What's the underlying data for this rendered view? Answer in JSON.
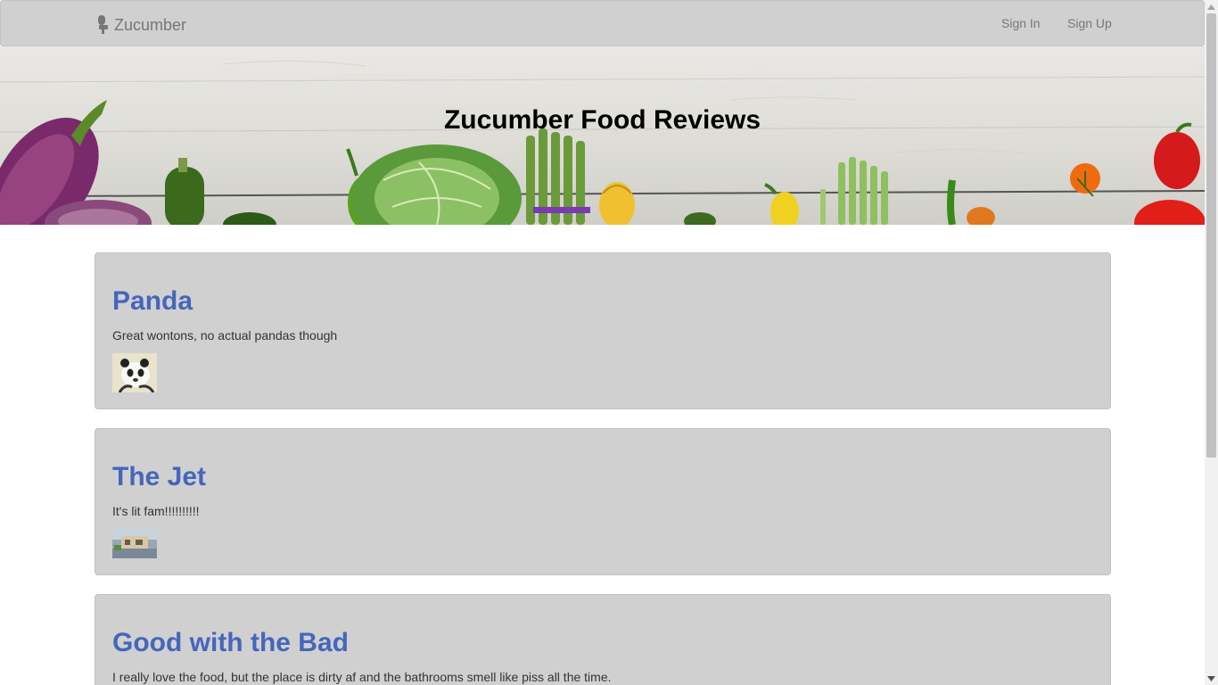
{
  "navbar": {
    "brand_icon": "ice-cream-icon",
    "brand": "Zucumber",
    "links": [
      {
        "label": "Sign In"
      },
      {
        "label": "Sign Up"
      }
    ]
  },
  "hero": {
    "title": "Zucumber Food Reviews"
  },
  "reviews": [
    {
      "title": "Panda",
      "text": "Great wontons, no actual pandas though",
      "image": "panda-thumbnail"
    },
    {
      "title": "The Jet",
      "text": "It's lit fam!!!!!!!!!!",
      "image": "restaurant-thumbnail"
    },
    {
      "title": "Good with the Bad",
      "text": "I really love the food, but the place is dirty af and the bathrooms smell like piss all the time."
    }
  ],
  "colors": {
    "navbar_bg": "#d0d0d0",
    "card_bg": "#d0d0d0",
    "link": "#4466bb",
    "muted_text": "#777777"
  }
}
